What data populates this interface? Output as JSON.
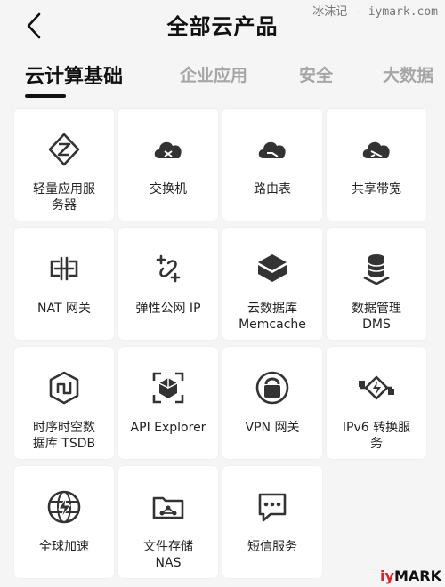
{
  "header": {
    "title": "全部云产品",
    "back_icon": "chevron-left-icon"
  },
  "watermark_top": "冰沫记 - iymark.com",
  "watermark_bottom": {
    "part1": "iy",
    "part2": "MARK"
  },
  "tabs": [
    {
      "label": "云计算基础",
      "active": true
    },
    {
      "label": "企业应用",
      "active": false
    },
    {
      "label": "安全",
      "active": false
    },
    {
      "label": "大数据",
      "active": false
    }
  ],
  "products": [
    {
      "line1": "轻量应用服",
      "line2": "务器",
      "icon": "lightweight-server-icon"
    },
    {
      "line1": "交换机",
      "line2": "",
      "icon": "cloud-switch-icon"
    },
    {
      "line1": "路由表",
      "line2": "",
      "icon": "cloud-route-icon"
    },
    {
      "line1": "共享带宽",
      "line2": "",
      "icon": "cloud-bandwidth-icon"
    },
    {
      "line1": "NAT 网关",
      "line2": "",
      "icon": "nat-gateway-icon"
    },
    {
      "line1": "弹性公网 IP",
      "line2": "",
      "icon": "elastic-ip-icon"
    },
    {
      "line1": "云数据库",
      "line2": "Memcache",
      "icon": "memcache-icon"
    },
    {
      "line1": "数据管理",
      "line2": "DMS",
      "icon": "database-icon"
    },
    {
      "line1": "时序时空数",
      "line2": "据库 TSDB",
      "icon": "tsdb-icon"
    },
    {
      "line1": "API Explorer",
      "line2": "",
      "icon": "api-explorer-icon"
    },
    {
      "line1": "VPN 网关",
      "line2": "",
      "icon": "vpn-lock-icon"
    },
    {
      "line1": "IPv6 转换服",
      "line2": "务",
      "icon": "ipv6-translation-icon"
    },
    {
      "line1": "全球加速",
      "line2": "",
      "icon": "globe-lightning-icon"
    },
    {
      "line1": "文件存储",
      "line2": "NAS",
      "icon": "folder-share-icon"
    },
    {
      "line1": "短信服务",
      "line2": "",
      "icon": "chat-bubble-icon"
    }
  ]
}
